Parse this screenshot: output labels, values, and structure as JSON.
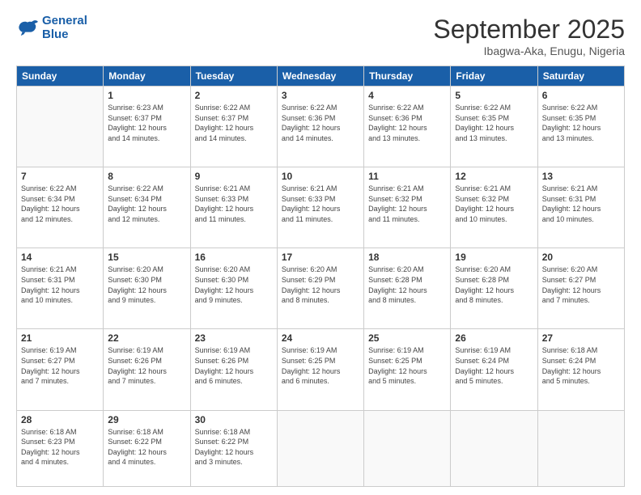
{
  "logo": {
    "line1": "General",
    "line2": "Blue"
  },
  "header": {
    "month": "September 2025",
    "location": "Ibagwa-Aka, Enugu, Nigeria"
  },
  "weekdays": [
    "Sunday",
    "Monday",
    "Tuesday",
    "Wednesday",
    "Thursday",
    "Friday",
    "Saturday"
  ],
  "weeks": [
    [
      {
        "day": "",
        "info": ""
      },
      {
        "day": "1",
        "info": "Sunrise: 6:23 AM\nSunset: 6:37 PM\nDaylight: 12 hours\nand 14 minutes."
      },
      {
        "day": "2",
        "info": "Sunrise: 6:22 AM\nSunset: 6:37 PM\nDaylight: 12 hours\nand 14 minutes."
      },
      {
        "day": "3",
        "info": "Sunrise: 6:22 AM\nSunset: 6:36 PM\nDaylight: 12 hours\nand 14 minutes."
      },
      {
        "day": "4",
        "info": "Sunrise: 6:22 AM\nSunset: 6:36 PM\nDaylight: 12 hours\nand 13 minutes."
      },
      {
        "day": "5",
        "info": "Sunrise: 6:22 AM\nSunset: 6:35 PM\nDaylight: 12 hours\nand 13 minutes."
      },
      {
        "day": "6",
        "info": "Sunrise: 6:22 AM\nSunset: 6:35 PM\nDaylight: 12 hours\nand 13 minutes."
      }
    ],
    [
      {
        "day": "7",
        "info": "Sunrise: 6:22 AM\nSunset: 6:34 PM\nDaylight: 12 hours\nand 12 minutes."
      },
      {
        "day": "8",
        "info": "Sunrise: 6:22 AM\nSunset: 6:34 PM\nDaylight: 12 hours\nand 12 minutes."
      },
      {
        "day": "9",
        "info": "Sunrise: 6:21 AM\nSunset: 6:33 PM\nDaylight: 12 hours\nand 11 minutes."
      },
      {
        "day": "10",
        "info": "Sunrise: 6:21 AM\nSunset: 6:33 PM\nDaylight: 12 hours\nand 11 minutes."
      },
      {
        "day": "11",
        "info": "Sunrise: 6:21 AM\nSunset: 6:32 PM\nDaylight: 12 hours\nand 11 minutes."
      },
      {
        "day": "12",
        "info": "Sunrise: 6:21 AM\nSunset: 6:32 PM\nDaylight: 12 hours\nand 10 minutes."
      },
      {
        "day": "13",
        "info": "Sunrise: 6:21 AM\nSunset: 6:31 PM\nDaylight: 12 hours\nand 10 minutes."
      }
    ],
    [
      {
        "day": "14",
        "info": "Sunrise: 6:21 AM\nSunset: 6:31 PM\nDaylight: 12 hours\nand 10 minutes."
      },
      {
        "day": "15",
        "info": "Sunrise: 6:20 AM\nSunset: 6:30 PM\nDaylight: 12 hours\nand 9 minutes."
      },
      {
        "day": "16",
        "info": "Sunrise: 6:20 AM\nSunset: 6:30 PM\nDaylight: 12 hours\nand 9 minutes."
      },
      {
        "day": "17",
        "info": "Sunrise: 6:20 AM\nSunset: 6:29 PM\nDaylight: 12 hours\nand 8 minutes."
      },
      {
        "day": "18",
        "info": "Sunrise: 6:20 AM\nSunset: 6:28 PM\nDaylight: 12 hours\nand 8 minutes."
      },
      {
        "day": "19",
        "info": "Sunrise: 6:20 AM\nSunset: 6:28 PM\nDaylight: 12 hours\nand 8 minutes."
      },
      {
        "day": "20",
        "info": "Sunrise: 6:20 AM\nSunset: 6:27 PM\nDaylight: 12 hours\nand 7 minutes."
      }
    ],
    [
      {
        "day": "21",
        "info": "Sunrise: 6:19 AM\nSunset: 6:27 PM\nDaylight: 12 hours\nand 7 minutes."
      },
      {
        "day": "22",
        "info": "Sunrise: 6:19 AM\nSunset: 6:26 PM\nDaylight: 12 hours\nand 7 minutes."
      },
      {
        "day": "23",
        "info": "Sunrise: 6:19 AM\nSunset: 6:26 PM\nDaylight: 12 hours\nand 6 minutes."
      },
      {
        "day": "24",
        "info": "Sunrise: 6:19 AM\nSunset: 6:25 PM\nDaylight: 12 hours\nand 6 minutes."
      },
      {
        "day": "25",
        "info": "Sunrise: 6:19 AM\nSunset: 6:25 PM\nDaylight: 12 hours\nand 5 minutes."
      },
      {
        "day": "26",
        "info": "Sunrise: 6:19 AM\nSunset: 6:24 PM\nDaylight: 12 hours\nand 5 minutes."
      },
      {
        "day": "27",
        "info": "Sunrise: 6:18 AM\nSunset: 6:24 PM\nDaylight: 12 hours\nand 5 minutes."
      }
    ],
    [
      {
        "day": "28",
        "info": "Sunrise: 6:18 AM\nSunset: 6:23 PM\nDaylight: 12 hours\nand 4 minutes."
      },
      {
        "day": "29",
        "info": "Sunrise: 6:18 AM\nSunset: 6:22 PM\nDaylight: 12 hours\nand 4 minutes."
      },
      {
        "day": "30",
        "info": "Sunrise: 6:18 AM\nSunset: 6:22 PM\nDaylight: 12 hours\nand 3 minutes."
      },
      {
        "day": "",
        "info": ""
      },
      {
        "day": "",
        "info": ""
      },
      {
        "day": "",
        "info": ""
      },
      {
        "day": "",
        "info": ""
      }
    ]
  ]
}
